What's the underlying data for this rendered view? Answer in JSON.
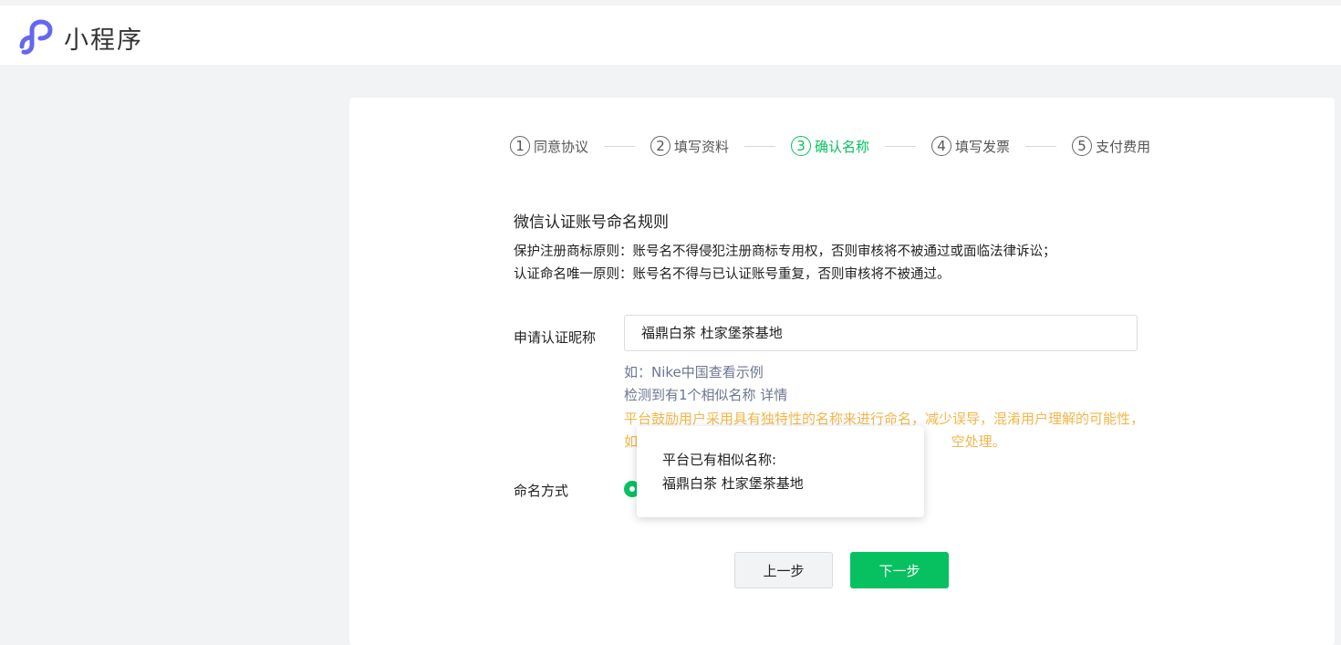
{
  "header": {
    "title": "小程序",
    "logo_icon": "miniprogram-logo-icon",
    "brand_color": "#6467f0"
  },
  "steps": [
    {
      "num": "1",
      "label": "同意协议",
      "active": false
    },
    {
      "num": "2",
      "label": "填写资料",
      "active": false
    },
    {
      "num": "3",
      "label": "确认名称",
      "active": true
    },
    {
      "num": "4",
      "label": "填写发票",
      "active": false
    },
    {
      "num": "5",
      "label": "支付费用",
      "active": false
    }
  ],
  "rules": {
    "title": "微信认证账号命名规则",
    "line1": "保护注册商标原则：账号名不得侵犯注册商标专用权，否则审核将不被通过或面临法律诉讼；",
    "line2": "认证命名唯一原则：账号名不得与已认证账号重复，否则审核将不被通过。"
  },
  "form": {
    "nickname_label": "申请认证昵称",
    "nickname_value": "福鼎白茶 杜家堡茶基地",
    "hint_example": "如：Nike中国查看示例",
    "hint_similar": "检测到有1个相似名称 详情",
    "warning_line1": "平台鼓励用户采用具有独特性的名称来进行命名，减少误导，混淆用户理解的可能性，",
    "warning_line2": "如",
    "warning_line2_tail": "空处理。",
    "method_label": "命名方式"
  },
  "popover": {
    "title": "平台已有相似名称:",
    "name": "福鼎白茶 杜家堡茶基地"
  },
  "buttons": {
    "prev": "上一步",
    "next": "下一步"
  },
  "colors": {
    "accent": "#07c160",
    "warning": "#f2b64a",
    "hint": "#6b7690"
  }
}
